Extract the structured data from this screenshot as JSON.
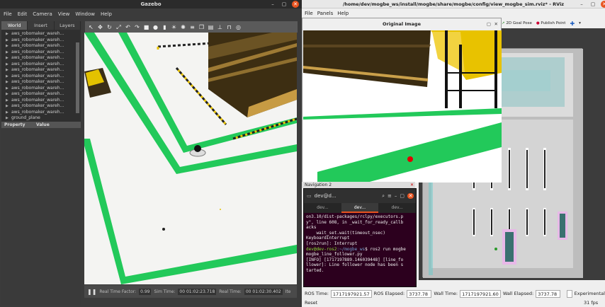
{
  "gazebo": {
    "title": "Gazebo",
    "menu": [
      "File",
      "Edit",
      "Camera",
      "View",
      "Window",
      "Help"
    ],
    "tabs": [
      "World",
      "Insert",
      "Layers"
    ],
    "tree": [
      "aws_robomaker_wareh...",
      "aws_robomaker_wareh...",
      "aws_robomaker_wareh...",
      "aws_robomaker_wareh...",
      "aws_robomaker_wareh...",
      "aws_robomaker_wareh...",
      "aws_robomaker_wareh...",
      "aws_robomaker_wareh...",
      "aws_robomaker_wareh...",
      "aws_robomaker_wareh...",
      "aws_robomaker_wareh...",
      "aws_robomaker_wareh...",
      "aws_robomaker_wareh...",
      "aws_robomaker_wareh...",
      "ground_plane",
      "..."
    ],
    "property_header": "Property",
    "value_header": "Value",
    "bottom": {
      "rtf_label": "Real Time Factor:",
      "rtf": "0.99",
      "sim_label": "Sim Time:",
      "sim": "00 01:02:23.718",
      "real_label": "Real Time:",
      "real": "00 01:02:30.402",
      "iter_label": "Ite"
    }
  },
  "rviz": {
    "title": "/home/dev/mogbe_ws/install/mogbe/share/mogbe/config/view_mogbe_sim.rviz* - RViz",
    "menu": [
      "File",
      "Panels",
      "Help"
    ],
    "tools": [
      "2D Goal Pose",
      "Publish Point"
    ],
    "original_image_title": "Original Image",
    "navigation_title": "Navigation 2",
    "status": {
      "ros_time_label": "ROS Time:",
      "ros_time": "1717197921.57",
      "ros_elapsed_label": "ROS Elapsed:",
      "ros_elapsed": "3737.78",
      "wall_time_label": "Wall Time:",
      "wall_time": "1717197921.60",
      "wall_elapsed_label": "Wall Elapsed:",
      "wall_elapsed": "3737.78",
      "experimental": "Experimental"
    },
    "reset": "Reset",
    "fps": "31 fps"
  },
  "terminal": {
    "title": "dev@d...",
    "tabs": [
      "dev...",
      "dev...",
      "dev..."
    ],
    "lines": [
      "on3.10/dist-packages/rclpy/executors.p",
      "y\", line 608, in _wait_for_ready_callb",
      "acks",
      "    wait_set.wait(timeout_nsec)",
      "KeyboardInterrupt",
      "[ros2run]: Interrupt"
    ],
    "prompt_user": "dev@dev-ros2",
    "prompt_path": ":~/mogbe_ws",
    "cmd": "$ ros2 run mogbe",
    "cmd2": "mogbe_line_follower.py",
    "out": [
      "[INFO] [1717197889.146039448] [line_fo",
      "llower]: Line follower node has been s",
      "tarted."
    ]
  }
}
